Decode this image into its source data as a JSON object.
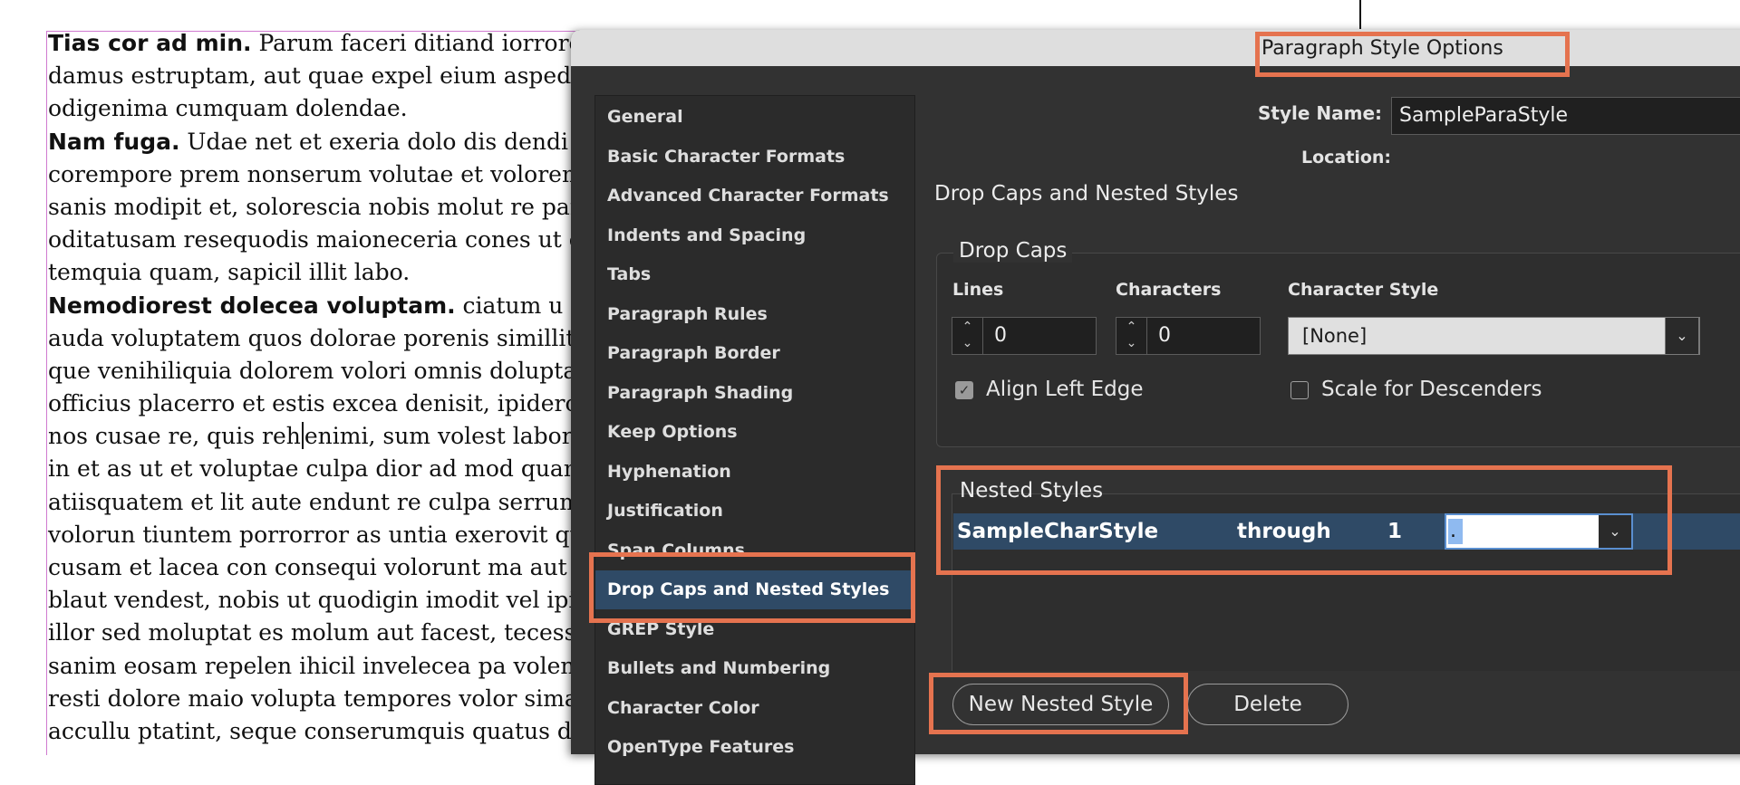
{
  "document": {
    "lines": [
      {
        "bold": "Tias cor ad min.",
        "text": " Parum faceri ditiand iorrore"
      },
      {
        "bold": "",
        "text": "damus estruptam, aut quae expel eium asped ma"
      },
      {
        "bold": "",
        "text": "odigenima cumquam dolendae."
      },
      {
        "bold": "Nam fuga.",
        "text": " Udae net et exeria dolo dis dendi re"
      },
      {
        "bold": "",
        "text": "corempore prem nonserum volutae et voloremq"
      },
      {
        "bold": "",
        "text": "sanis modipit et, solorescia nobis molut re parum"
      },
      {
        "bold": "",
        "text": "oditatusam resequodis maioneceria cones ut el i"
      },
      {
        "bold": "",
        "text": "temquia quam, sapicil illit labo."
      },
      {
        "bold": "Nemodiorest dolecea voluptam.",
        "text": " ciatum u"
      },
      {
        "bold": "",
        "text": "auda voluptatem quos dolorae porenis simillit pa"
      },
      {
        "bold": "",
        "text": "que venihiliquia dolorem volori omnis dolupta s"
      },
      {
        "bold": "",
        "text": "officius placerro et estis excea denisit, ipiderora s"
      },
      {
        "bold": "",
        "text": "nos cusae re, quis reh",
        "caret": true,
        "after": "enimi, sum volest laborehe"
      },
      {
        "bold": "",
        "text": "in et as ut et voluptae culpa dior ad mod quam i"
      },
      {
        "bold": "",
        "text": "atiisquatem et lit aute endunt re culpa serrum la"
      },
      {
        "bold": "",
        "text": "volorun tiuntem porrorror as untia exerovit qua"
      },
      {
        "bold": "",
        "text": "cusam et lacea con consequi volorunt ma aut de"
      },
      {
        "bold": "",
        "text": "blaut vendest, nobis ut quodigin imodit vel ipide"
      },
      {
        "bold": "",
        "text": "illor sed moluptat es molum aut facest, tecessi n"
      },
      {
        "bold": "",
        "text": "sanim eosam repelen ihicil invelecea pa volente"
      },
      {
        "bold": "",
        "text": "resti dolore maio volupta tempores volor simaxi"
      },
      {
        "bold": "",
        "text": "accullu ptatint, seque conserumquis quatus dolu"
      }
    ]
  },
  "dialog": {
    "title": "Paragraph Style Options",
    "style_name_label": "Style Name:",
    "style_name_value": "SampleParaStyle",
    "location_label": "Location:",
    "section_title": "Drop Caps and Nested Styles",
    "sidebar": {
      "items": [
        {
          "label": "General",
          "selected": false
        },
        {
          "label": "Basic Character Formats",
          "selected": false
        },
        {
          "label": "Advanced Character Formats",
          "selected": false
        },
        {
          "label": "Indents and Spacing",
          "selected": false
        },
        {
          "label": "Tabs",
          "selected": false
        },
        {
          "label": "Paragraph Rules",
          "selected": false
        },
        {
          "label": "Paragraph Border",
          "selected": false
        },
        {
          "label": "Paragraph Shading",
          "selected": false
        },
        {
          "label": "Keep Options",
          "selected": false
        },
        {
          "label": "Hyphenation",
          "selected": false
        },
        {
          "label": "Justification",
          "selected": false
        },
        {
          "label": "Span Columns",
          "selected": false
        },
        {
          "label": "Drop Caps and Nested Styles",
          "selected": true
        },
        {
          "label": "GREP Style",
          "selected": false
        },
        {
          "label": "Bullets and Numbering",
          "selected": false
        },
        {
          "label": "Character Color",
          "selected": false
        },
        {
          "label": "OpenType Features",
          "selected": false
        }
      ]
    },
    "drop_caps": {
      "group_title": "Drop Caps",
      "lines_label": "Lines",
      "lines_value": "0",
      "characters_label": "Characters",
      "characters_value": "0",
      "character_style_label": "Character Style",
      "character_style_value": "[None]",
      "align_left_edge_label": "Align Left Edge",
      "align_left_edge_checked": true,
      "scale_for_descenders_label": "Scale for Descenders",
      "scale_for_descenders_checked": false
    },
    "nested_styles": {
      "title": "Nested Styles",
      "row": {
        "char_style": "SampleCharStyle",
        "mode": "through",
        "count": "1",
        "delimiter": "."
      }
    },
    "buttons": {
      "new_nested_style": "New Nested Style",
      "delete": "Delete"
    }
  },
  "colors": {
    "dialog_bg": "#323232",
    "selection": "#2f4a66",
    "highlight": "#e5734f",
    "titlebar": "#dedede"
  }
}
